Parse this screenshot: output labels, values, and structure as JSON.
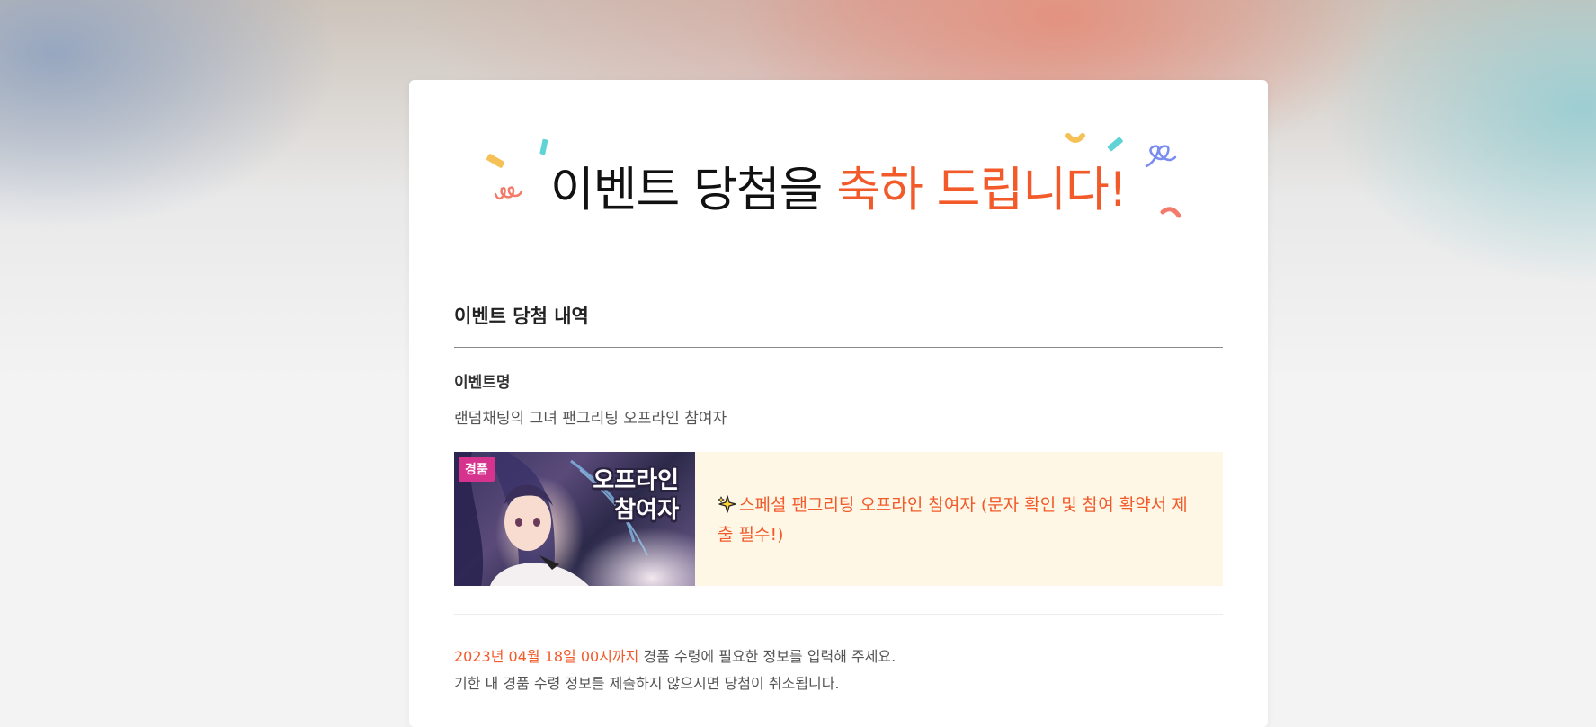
{
  "headline": {
    "main": "이벤트 당첨을",
    "accent": "축하 드립니다!"
  },
  "section": {
    "title": "이벤트 당첨 내역"
  },
  "event": {
    "name_label": "이벤트명",
    "name_value": "랜덤채팅의 그녀 팬그리팅 오프라인 참여자"
  },
  "prize": {
    "badge": "경품",
    "image_text": "오프라인\n참여자",
    "description": "스페셜 팬그리팅 오프라인 참여자 (문자 확인 및 참여 확약서 제출 필수!)",
    "icon": "sparkles-icon"
  },
  "notice": {
    "deadline": "2023년 04월 18일 00시까지",
    "line1_rest": " 경품 수령에 필요한 정보를 입력해 주세요.",
    "line2": "기한 내 경품 수령 정보를 제출하지 않으시면 당첨이 취소됩니다."
  },
  "colors": {
    "accent": "#f25a2a",
    "prize_background": "#fff7e6",
    "badge": "#d6338f",
    "confetti_yellow": "#f5c156",
    "confetti_teal": "#5fd3d6",
    "confetti_blue": "#7a8cf0",
    "confetti_pink": "#f27b6b"
  }
}
